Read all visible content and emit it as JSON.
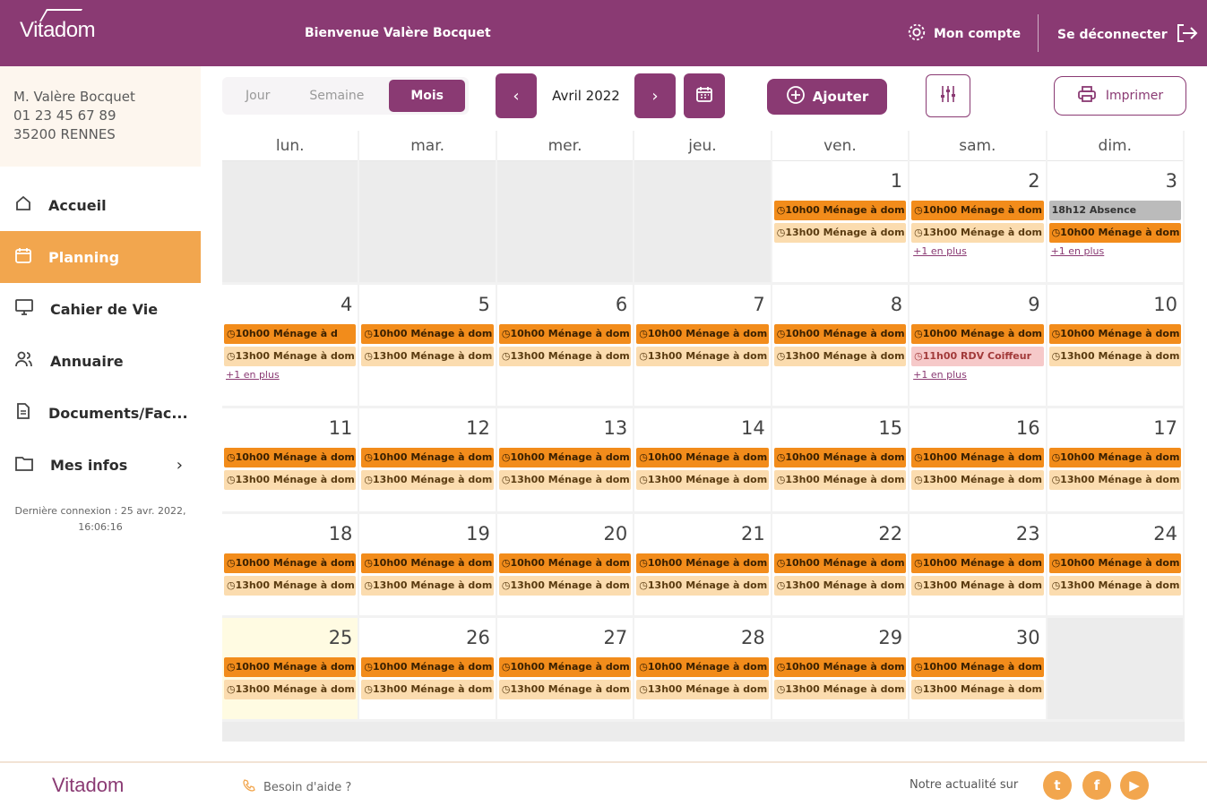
{
  "header": {
    "logo": "Vitadom",
    "welcome": "Bienvenue Valère Bocquet",
    "account": "Mon compte",
    "logout": "Se déconnecter"
  },
  "user": {
    "name": "M. Valère Bocquet",
    "phone": "01 23 45 67 89",
    "city": "35200 RENNES"
  },
  "nav": [
    {
      "label": "Accueil",
      "icon": "home-icon"
    },
    {
      "label": "Planning",
      "icon": "calendar-icon",
      "active": true
    },
    {
      "label": "Cahier de Vie",
      "icon": "monitor-icon"
    },
    {
      "label": "Annuaire",
      "icon": "people-icon"
    },
    {
      "label": "Documents/Fac...",
      "icon": "document-icon"
    },
    {
      "label": "Mes infos",
      "icon": "folder-icon"
    }
  ],
  "last_login": "Dernière connexion : 25 avr. 2022, 16:06:16",
  "toolbar": {
    "views": [
      "Jour",
      "Semaine",
      "Mois"
    ],
    "active_view": "Mois",
    "month": "Avril 2022",
    "prev": "‹",
    "next": "›",
    "add": "Ajouter",
    "print": "Imprimer"
  },
  "calendar": {
    "weekdays": [
      "lun.",
      "mar.",
      "mer.",
      "jeu.",
      "ven.",
      "sam.",
      "dim."
    ],
    "more_label": "+1 en plus",
    "weeks": [
      [
        {
          "day": "",
          "events": []
        },
        {
          "day": "",
          "events": []
        },
        {
          "day": "",
          "events": []
        },
        {
          "day": "",
          "events": []
        },
        {
          "day": "1",
          "events": [
            {
              "t": "10h00",
              "label": "Ménage à dom",
              "c": "orange"
            },
            {
              "t": "13h00",
              "label": "Ménage à dom",
              "c": "light"
            }
          ]
        },
        {
          "day": "2",
          "events": [
            {
              "t": "10h00",
              "label": "Ménage à dom",
              "c": "orange"
            },
            {
              "t": "13h00",
              "label": "Ménage à dom",
              "c": "light"
            }
          ],
          "more": true
        },
        {
          "day": "3",
          "events": [
            {
              "t": "18h12",
              "label": "Absence",
              "c": "gray",
              "noclock": true
            },
            {
              "t": "10h00",
              "label": "Ménage à dom",
              "c": "orange"
            }
          ],
          "more": true
        }
      ],
      [
        {
          "day": "4",
          "events": [
            {
              "t": "10h00",
              "label": "Ménage à d",
              "c": "orange"
            },
            {
              "t": "13h00",
              "label": "Ménage à dom",
              "c": "light"
            }
          ],
          "more": true
        },
        {
          "day": "5",
          "events": [
            {
              "t": "10h00",
              "label": "Ménage à dom",
              "c": "orange"
            },
            {
              "t": "13h00",
              "label": "Ménage à dom",
              "c": "light"
            }
          ]
        },
        {
          "day": "6",
          "events": [
            {
              "t": "10h00",
              "label": "Ménage à dom",
              "c": "orange"
            },
            {
              "t": "13h00",
              "label": "Ménage à dom",
              "c": "light"
            }
          ]
        },
        {
          "day": "7",
          "events": [
            {
              "t": "10h00",
              "label": "Ménage à dom",
              "c": "orange"
            },
            {
              "t": "13h00",
              "label": "Ménage à dom",
              "c": "light"
            }
          ]
        },
        {
          "day": "8",
          "events": [
            {
              "t": "10h00",
              "label": "Ménage à dom",
              "c": "orange"
            },
            {
              "t": "13h00",
              "label": "Ménage à dom",
              "c": "light"
            }
          ]
        },
        {
          "day": "9",
          "events": [
            {
              "t": "10h00",
              "label": "Ménage à dom",
              "c": "orange"
            },
            {
              "t": "11h00",
              "label": "RDV Coiffeur",
              "c": "pink"
            }
          ],
          "more": true
        },
        {
          "day": "10",
          "events": [
            {
              "t": "10h00",
              "label": "Ménage à dom",
              "c": "orange"
            },
            {
              "t": "13h00",
              "label": "Ménage à dom",
              "c": "light"
            }
          ]
        }
      ],
      [
        {
          "day": "11",
          "events": [
            {
              "t": "10h00",
              "label": "Ménage à dom",
              "c": "orange"
            },
            {
              "t": "13h00",
              "label": "Ménage à dom",
              "c": "light"
            }
          ]
        },
        {
          "day": "12",
          "events": [
            {
              "t": "10h00",
              "label": "Ménage à dom",
              "c": "orange"
            },
            {
              "t": "13h00",
              "label": "Ménage à dom",
              "c": "light"
            }
          ]
        },
        {
          "day": "13",
          "events": [
            {
              "t": "10h00",
              "label": "Ménage à dom",
              "c": "orange"
            },
            {
              "t": "13h00",
              "label": "Ménage à dom",
              "c": "light"
            }
          ]
        },
        {
          "day": "14",
          "events": [
            {
              "t": "10h00",
              "label": "Ménage à dom",
              "c": "orange"
            },
            {
              "t": "13h00",
              "label": "Ménage à dom",
              "c": "light"
            }
          ]
        },
        {
          "day": "15",
          "events": [
            {
              "t": "10h00",
              "label": "Ménage à dom",
              "c": "orange"
            },
            {
              "t": "13h00",
              "label": "Ménage à dom",
              "c": "light"
            }
          ]
        },
        {
          "day": "16",
          "events": [
            {
              "t": "10h00",
              "label": "Ménage à dom",
              "c": "orange"
            },
            {
              "t": "13h00",
              "label": "Ménage à dom",
              "c": "light"
            }
          ]
        },
        {
          "day": "17",
          "events": [
            {
              "t": "10h00",
              "label": "Ménage à dom",
              "c": "orange"
            },
            {
              "t": "13h00",
              "label": "Ménage à dom",
              "c": "light"
            }
          ]
        }
      ],
      [
        {
          "day": "18",
          "events": [
            {
              "t": "10h00",
              "label": "Ménage à dom",
              "c": "orange"
            },
            {
              "t": "13h00",
              "label": "Ménage à dom",
              "c": "light"
            }
          ]
        },
        {
          "day": "19",
          "events": [
            {
              "t": "10h00",
              "label": "Ménage à dom",
              "c": "orange"
            },
            {
              "t": "13h00",
              "label": "Ménage à dom",
              "c": "light"
            }
          ]
        },
        {
          "day": "20",
          "events": [
            {
              "t": "10h00",
              "label": "Ménage à dom",
              "c": "orange"
            },
            {
              "t": "13h00",
              "label": "Ménage à dom",
              "c": "light"
            }
          ]
        },
        {
          "day": "21",
          "events": [
            {
              "t": "10h00",
              "label": "Ménage à dom",
              "c": "orange"
            },
            {
              "t": "13h00",
              "label": "Ménage à dom",
              "c": "light"
            }
          ]
        },
        {
          "day": "22",
          "events": [
            {
              "t": "10h00",
              "label": "Ménage à dom",
              "c": "orange"
            },
            {
              "t": "13h00",
              "label": "Ménage à dom",
              "c": "light"
            }
          ]
        },
        {
          "day": "23",
          "events": [
            {
              "t": "10h00",
              "label": "Ménage à dom",
              "c": "orange"
            },
            {
              "t": "13h00",
              "label": "Ménage à dom",
              "c": "light"
            }
          ]
        },
        {
          "day": "24",
          "events": [
            {
              "t": "10h00",
              "label": "Ménage à dom",
              "c": "orange"
            },
            {
              "t": "13h00",
              "label": "Ménage à dom",
              "c": "light"
            }
          ]
        }
      ],
      [
        {
          "day": "25",
          "today": true,
          "events": [
            {
              "t": "10h00",
              "label": "Ménage à dom",
              "c": "orange"
            },
            {
              "t": "13h00",
              "label": "Ménage à dom",
              "c": "light"
            }
          ]
        },
        {
          "day": "26",
          "events": [
            {
              "t": "10h00",
              "label": "Ménage à dom",
              "c": "orange"
            },
            {
              "t": "13h00",
              "label": "Ménage à dom",
              "c": "light"
            }
          ]
        },
        {
          "day": "27",
          "events": [
            {
              "t": "10h00",
              "label": "Ménage à dom",
              "c": "orange"
            },
            {
              "t": "13h00",
              "label": "Ménage à dom",
              "c": "light"
            }
          ]
        },
        {
          "day": "28",
          "events": [
            {
              "t": "10h00",
              "label": "Ménage à dom",
              "c": "orange"
            },
            {
              "t": "13h00",
              "label": "Ménage à dom",
              "c": "light"
            }
          ]
        },
        {
          "day": "29",
          "events": [
            {
              "t": "10h00",
              "label": "Ménage à dom",
              "c": "orange"
            },
            {
              "t": "13h00",
              "label": "Ménage à dom",
              "c": "light"
            }
          ]
        },
        {
          "day": "30",
          "events": [
            {
              "t": "10h00",
              "label": "Ménage à dom",
              "c": "orange"
            },
            {
              "t": "13h00",
              "label": "Ménage à dom",
              "c": "light"
            }
          ]
        },
        {
          "day": "",
          "events": []
        }
      ]
    ]
  },
  "footer": {
    "logo": "Vitadom",
    "help": "Besoin d'aide ?",
    "news": "Notre actualité sur",
    "social": [
      {
        "name": "twitter-icon",
        "glyph": "t"
      },
      {
        "name": "facebook-icon",
        "glyph": "f"
      },
      {
        "name": "youtube-icon",
        "glyph": "▶"
      }
    ]
  },
  "colors": {
    "primary": "#8a3a73",
    "accent": "#f2a64e",
    "event_orange": "#f28c1b",
    "event_light": "#fbdcaf"
  }
}
